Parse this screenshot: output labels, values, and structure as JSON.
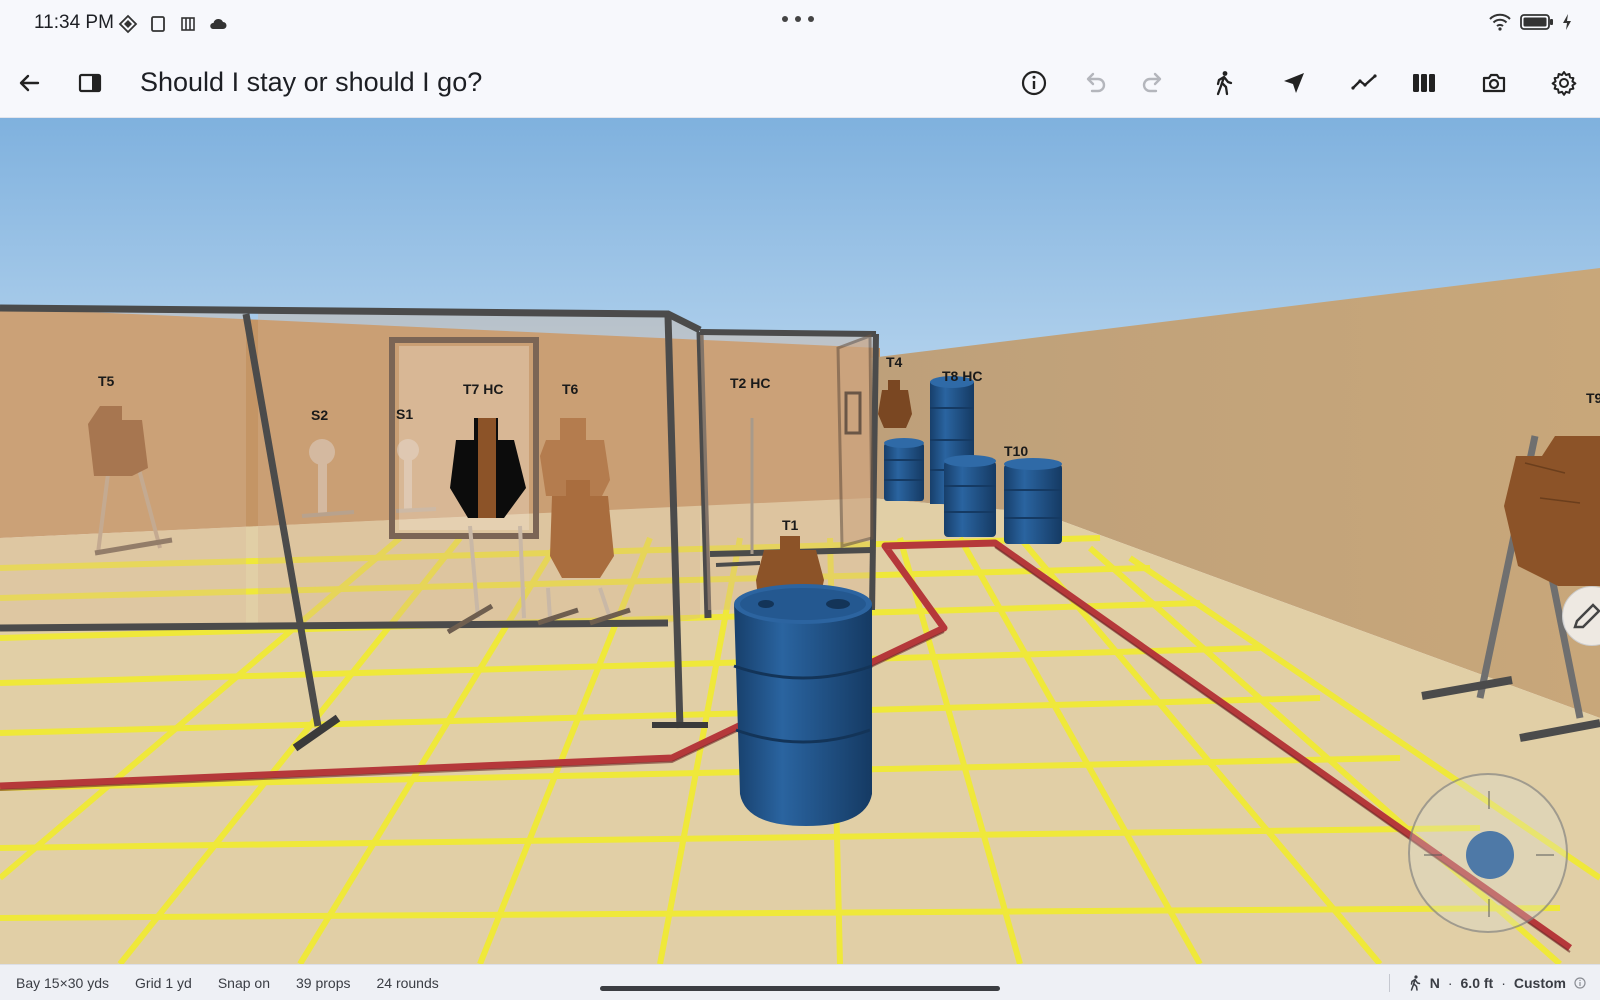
{
  "status": {
    "time": "11:34 PM",
    "left_icons": [
      "sim-diamond-icon",
      "tablet-icon",
      "notes-icon",
      "cloud-icon"
    ],
    "right_icons": [
      "wifi-icon",
      "battery-icon",
      "charging-icon"
    ]
  },
  "toolbar": {
    "title": "Should I stay or should I go?",
    "buttons": [
      "back-arrow-icon",
      "sidebar-panel-icon",
      "info-icon",
      "undo-icon",
      "redo-icon",
      "walk-icon",
      "navigate-icon",
      "path-line-icon",
      "columns-icon",
      "camera-icon",
      "settings-gear-icon"
    ]
  },
  "scene": {
    "target_labels": {
      "t5": "T5",
      "s2": "S2",
      "s1": "S1",
      "t7": "T7 HC",
      "t6": "T6",
      "t2": "T2 HC",
      "t4": "T4",
      "t8": "T8 HC",
      "t10": "T10",
      "t1": "T1",
      "t9": "T9"
    },
    "colors": {
      "sky_top": "#7fb1de",
      "sky_bottom": "#c7e0f4",
      "floor": "#e1cfa6",
      "grid": "#efe83a",
      "wall": "#c8a77a",
      "barrel": "#1f5791",
      "fault_line": "#b5383a",
      "target": "#8c5328"
    }
  },
  "bottombar": {
    "bay": "Bay 15×30 yds",
    "grid": "Grid 1 yd",
    "snap": "Snap on",
    "props": "39 props",
    "rounds": "24 rounds",
    "heading": "N",
    "height": "6.0 ft",
    "mode": "Custom"
  }
}
